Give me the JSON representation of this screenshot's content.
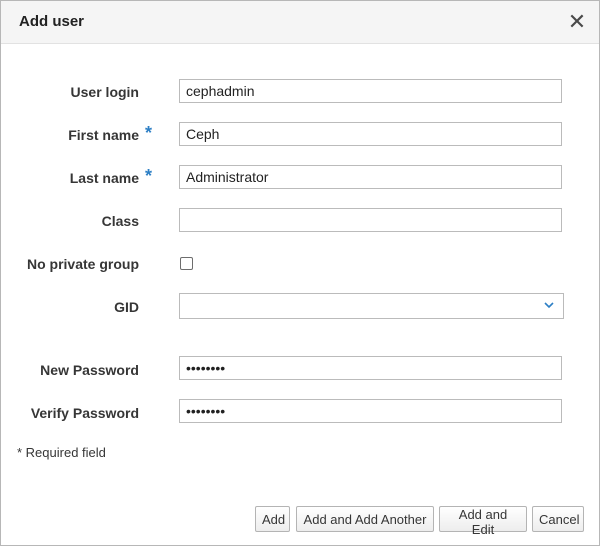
{
  "dialog": {
    "title": "Add user",
    "close_icon": "close-icon"
  },
  "fields": {
    "user_login": {
      "label": "User login",
      "value": "cephadmin"
    },
    "first_name": {
      "label": "First name",
      "required_marker": "*",
      "value": "Ceph"
    },
    "last_name": {
      "label": "Last name",
      "required_marker": "*",
      "value": "Administrator"
    },
    "class": {
      "label": "Class",
      "value": ""
    },
    "no_private_group": {
      "label": "No private group",
      "checked": false
    },
    "gid": {
      "label": "GID",
      "selected": "",
      "icon": "chevron-down-icon"
    },
    "new_password": {
      "label": "New Password",
      "value": "••••••••"
    },
    "verify_password": {
      "label": "Verify Password",
      "value": "••••••••"
    }
  },
  "required_note": "* Required field",
  "buttons": {
    "add": "Add",
    "add_and_add_another": "Add and Add Another",
    "add_and_edit": "Add and Edit",
    "cancel": "Cancel"
  },
  "colors": {
    "required_accent": "#2d7fc5",
    "header_bg": "#f5f5f5"
  }
}
